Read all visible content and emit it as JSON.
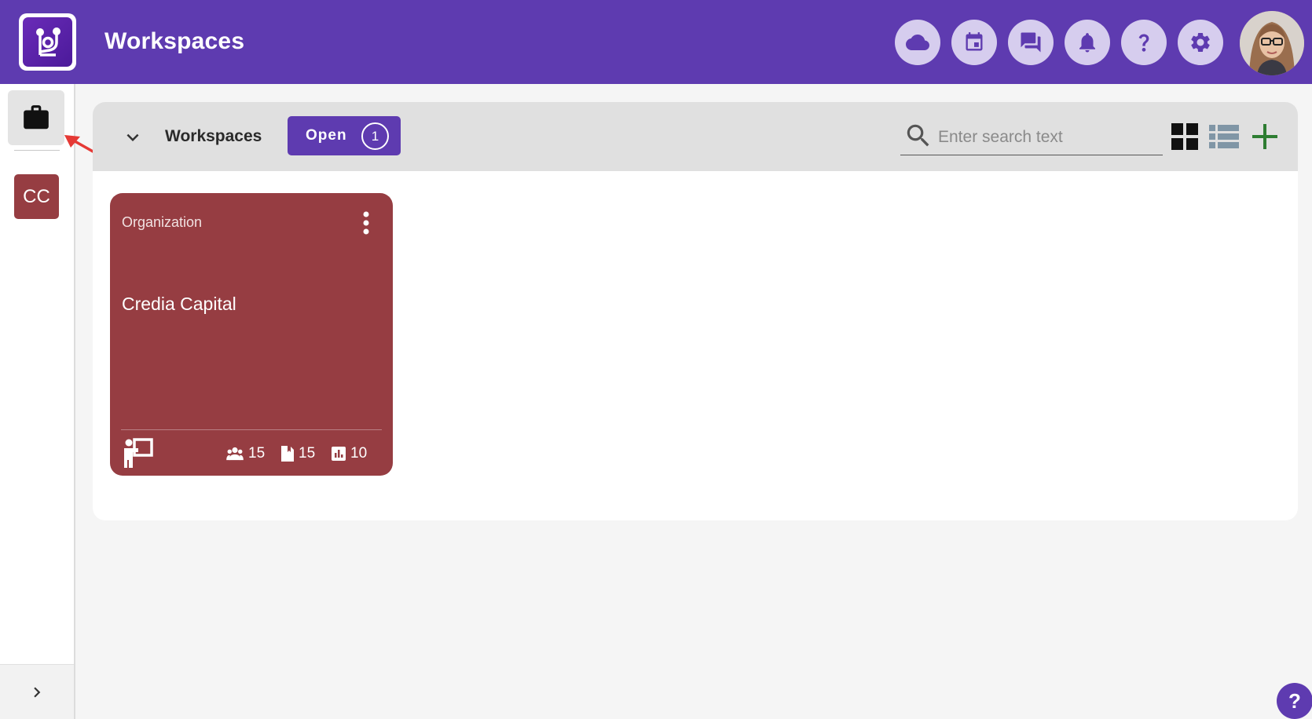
{
  "header": {
    "title": "Workspaces",
    "icons": [
      "cloud-icon",
      "calendar-icon",
      "chat-icon",
      "bell-icon",
      "help-icon",
      "settings-icon"
    ]
  },
  "sidebar": {
    "active_icon": "briefcase-icon",
    "workspace_initials": "CC",
    "expand_icon": "chevron-right-icon"
  },
  "panel": {
    "title": "Workspaces",
    "filter": {
      "label": "Open",
      "count": "1"
    },
    "search": {
      "placeholder": "Enter search text",
      "value": ""
    }
  },
  "cards": [
    {
      "type": "Organization",
      "name": "Credia Capital",
      "stats": {
        "members": "15",
        "documents": "15",
        "reports": "10"
      }
    }
  ],
  "help_fab": "?",
  "colors": {
    "brand": "#5e3bb0",
    "card": "#963d42",
    "add": "#2e7d32",
    "annotation_arrow": "#e53935"
  }
}
